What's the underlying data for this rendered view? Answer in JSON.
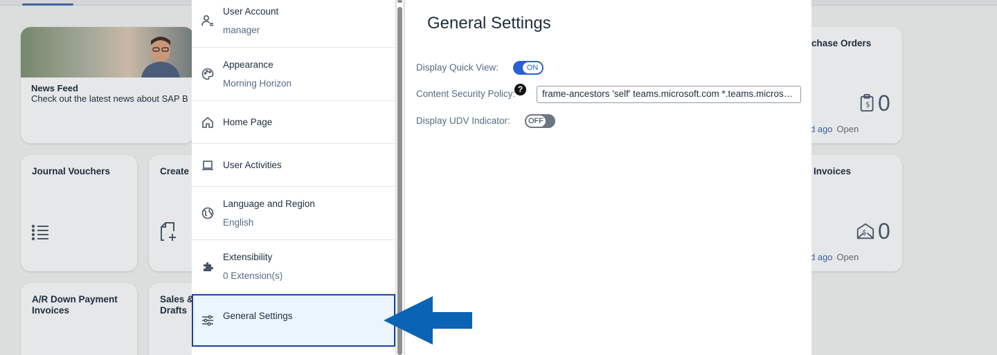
{
  "background": {
    "tiles": {
      "news": {
        "title": "News Feed",
        "text": "Check out the latest news about SAP B"
      },
      "journal": {
        "title": "Journal Vouchers"
      },
      "create": {
        "title": "Create"
      },
      "ar_down": {
        "title": "A/R Down Payment\nInvoices"
      },
      "sales": {
        "title": "Sales &\nDrafts"
      },
      "purchase": {
        "title": "chase Orders",
        "count": "0",
        "ago": "d ago",
        "open": "Open"
      },
      "invoices": {
        "title": "Invoices",
        "count": "0",
        "ago": "d ago",
        "open": "Open"
      }
    }
  },
  "sidebar": {
    "items": [
      {
        "label": "User Account",
        "sub": "manager",
        "icon": "user-account-icon"
      },
      {
        "label": "Appearance",
        "sub": "Morning Horizon",
        "icon": "palette-icon"
      },
      {
        "label": "Home Page",
        "icon": "home-icon"
      },
      {
        "label": "User Activities",
        "icon": "laptop-icon"
      },
      {
        "label": "Language and Region",
        "sub": "English",
        "icon": "globe-icon"
      },
      {
        "label": "Extensibility",
        "sub": "0 Extension(s)",
        "icon": "puzzle-icon"
      },
      {
        "label": "General Settings",
        "icon": "sliders-icon",
        "selected": true
      }
    ]
  },
  "main": {
    "title": "General Settings",
    "display_quick_view": {
      "label": "Display Quick View:",
      "state": "ON"
    },
    "csp": {
      "label": "Content Security Policy:",
      "help": "?",
      "value": "frame-ancestors 'self' teams.microsoft.com *.teams.microsoft.com"
    },
    "display_udv": {
      "label": "Display UDV Indicator:",
      "state": "OFF"
    }
  },
  "colors": {
    "accent": "#2a5fd4",
    "selected_bg": "#ebf5fe",
    "selected_border": "#1e3fa0",
    "arrow": "#0b63b3"
  }
}
